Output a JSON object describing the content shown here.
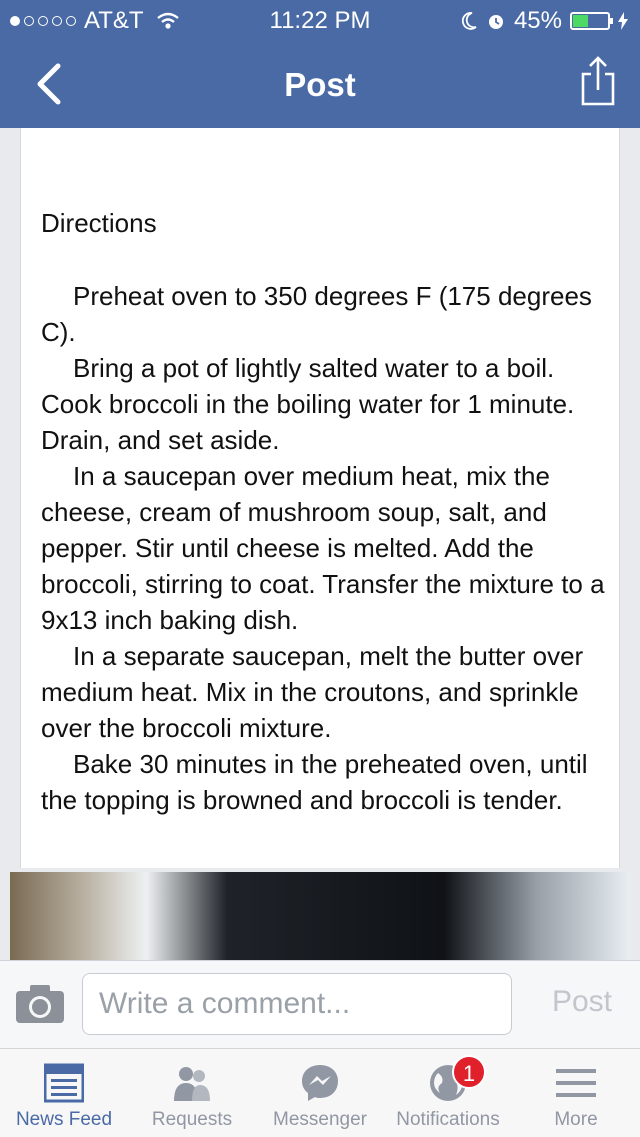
{
  "status_bar": {
    "carrier": "AT&T",
    "time": "11:22 PM",
    "battery_percent": "45%",
    "signal_bars_filled": 1,
    "battery_level": 0.45
  },
  "nav": {
    "title": "Post",
    "back_icon": "chevron-left-icon",
    "share_icon": "share-icon"
  },
  "post": {
    "heading": "Directions",
    "steps": [
      "Preheat oven to 350 degrees F (175 degrees C).",
      "Bring a pot of lightly salted water to a boil. Cook broccoli in the boiling water for 1 minute. Drain, and set aside.",
      "In a saucepan over medium heat, mix the cheese, cream of mushroom soup, salt, and pepper. Stir until cheese is melted. Add the broccoli, stirring to coat. Transfer the mixture to a 9x13 inch baking dish.",
      "In a separate saucepan, melt the butter over medium heat. Mix in the croutons, and sprinkle over the broccoli mixture.",
      "Bake 30 minutes in the preheated oven, until the topping is browned and broccoli is tender."
    ]
  },
  "comment_bar": {
    "placeholder": "Write a comment...",
    "value": "",
    "post_label": "Post"
  },
  "tabs": [
    {
      "label": "News Feed",
      "icon": "news-feed-icon",
      "active": true
    },
    {
      "label": "Requests",
      "icon": "friend-requests-icon",
      "active": false
    },
    {
      "label": "Messenger",
      "icon": "messenger-icon",
      "active": false
    },
    {
      "label": "Notifications",
      "icon": "globe-icon",
      "active": false,
      "badge": "1"
    },
    {
      "label": "More",
      "icon": "menu-icon",
      "active": false
    }
  ],
  "colors": {
    "brand": "#4a6aa6",
    "badge": "#e0202a",
    "battery": "#4cd964"
  }
}
